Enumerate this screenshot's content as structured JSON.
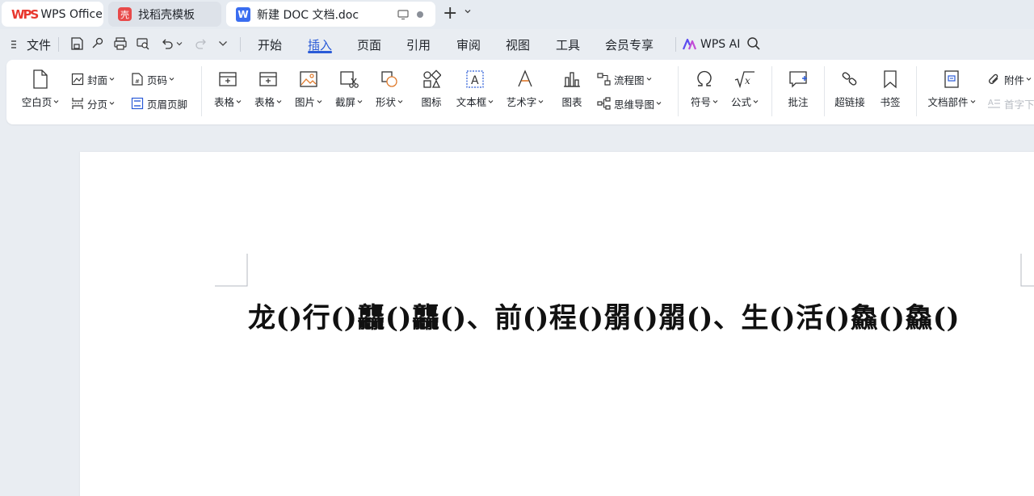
{
  "tabs": {
    "wps": {
      "label": "WPS Office",
      "logo": "WPS"
    },
    "template": {
      "label": "找稻壳模板",
      "logo": "壳"
    },
    "document": {
      "label": "新建 DOC 文档.doc",
      "logo": "W"
    }
  },
  "menu": {
    "file": "文件",
    "tabs": [
      "开始",
      "插入",
      "页面",
      "引用",
      "审阅",
      "视图",
      "工具",
      "会员专享"
    ],
    "active_tab": "插入",
    "ai": "WPS AI"
  },
  "ribbon": {
    "blank_page": "空白页",
    "cover": "封面",
    "page_break": "分页",
    "page_number": "页码",
    "header_footer": "页眉页脚",
    "table1": "表格",
    "table2": "表格",
    "picture": "图片",
    "screenshot": "截屏",
    "shape": "形状",
    "icon": "图标",
    "textbox": "文本框",
    "wordart": "艺术字",
    "chart": "图表",
    "flowchart": "流程图",
    "mindmap": "思维导图",
    "symbol": "符号",
    "formula": "公式",
    "comment": "批注",
    "hyperlink": "超链接",
    "bookmark": "书签",
    "doc_parts": "文档部件",
    "attachment": "附件",
    "drop_cap": "首字下"
  },
  "document": {
    "text": "龙()行()龘()龘()、前()程()朤()朤()、生()活()鱻()鱻()"
  },
  "colors": {
    "accent": "#2a5bd7",
    "wps_red": "#e8382f",
    "background": "#e9edf2"
  }
}
